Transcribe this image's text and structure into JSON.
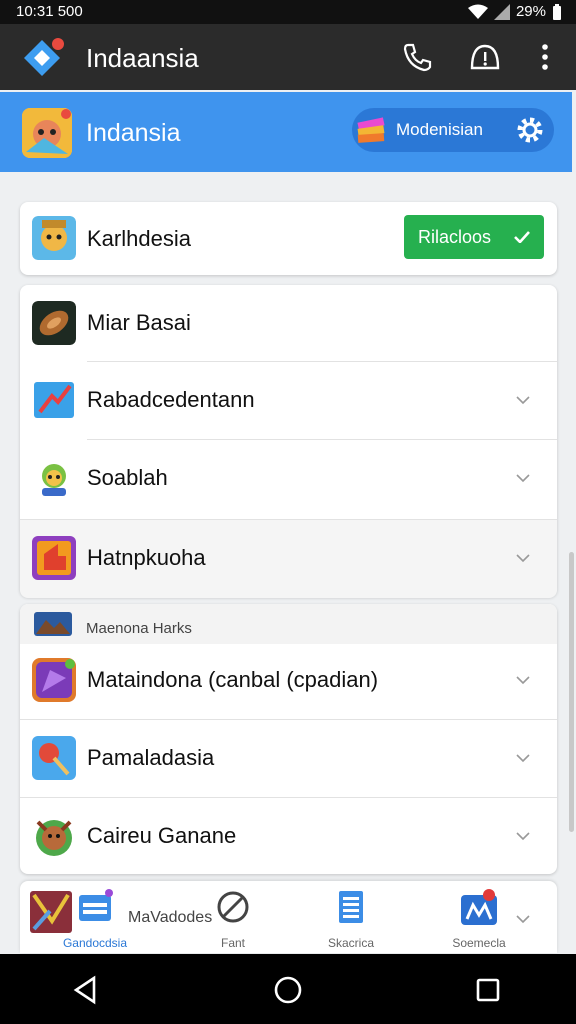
{
  "status_bar": {
    "time": "10:31 500",
    "battery": "29%"
  },
  "app_bar": {
    "title": "Indaansia"
  },
  "header": {
    "title": "Indansia",
    "pill_label": "Modenisian"
  },
  "featured": {
    "label": "Karlhdesia",
    "button_label": "Rilacloos"
  },
  "list_section_1": {
    "items": [
      {
        "label": "Miar Basai"
      },
      {
        "label": "Rabadcedentann"
      },
      {
        "label": "Soablah"
      },
      {
        "label": "Hatnpkuoha"
      }
    ]
  },
  "list_section_2": {
    "heading": "Maenona Harks",
    "items": [
      {
        "label": "Mataindona (canbal (cpadian)"
      },
      {
        "label": "Pamaladasia"
      },
      {
        "label": "Caireu Ganane"
      }
    ]
  },
  "bottom_nav": {
    "items": [
      {
        "label": "Gandocdsia"
      },
      {
        "label": "MaVadodes"
      },
      {
        "label": "Fant"
      },
      {
        "label": "Skacrica"
      },
      {
        "label": "Soemecla"
      }
    ]
  },
  "colors": {
    "header_blue": "#3f94ee",
    "green_button": "#26b04f",
    "app_bar": "#2b2b2b"
  }
}
